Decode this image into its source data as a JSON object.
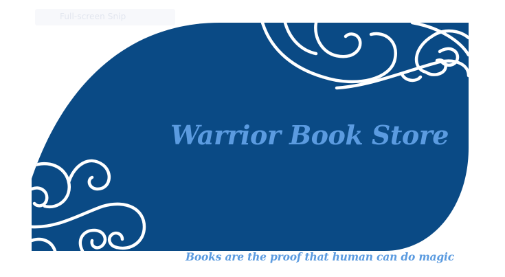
{
  "snip_toolbar": {
    "label": "Full-screen Snip"
  },
  "slide": {
    "title": "Warrior Book Store",
    "tagline": "Books are the proof that human can do magic"
  },
  "colors": {
    "banner_blue": "#0a4a85",
    "title_blue": "#5b9be0",
    "swirl_white": "#ffffff",
    "background": "#ffffff"
  },
  "icons": {
    "top_right_ornament": "swirl-ornament-icon",
    "bottom_left_ornament": "swirl-ornament-icon"
  }
}
